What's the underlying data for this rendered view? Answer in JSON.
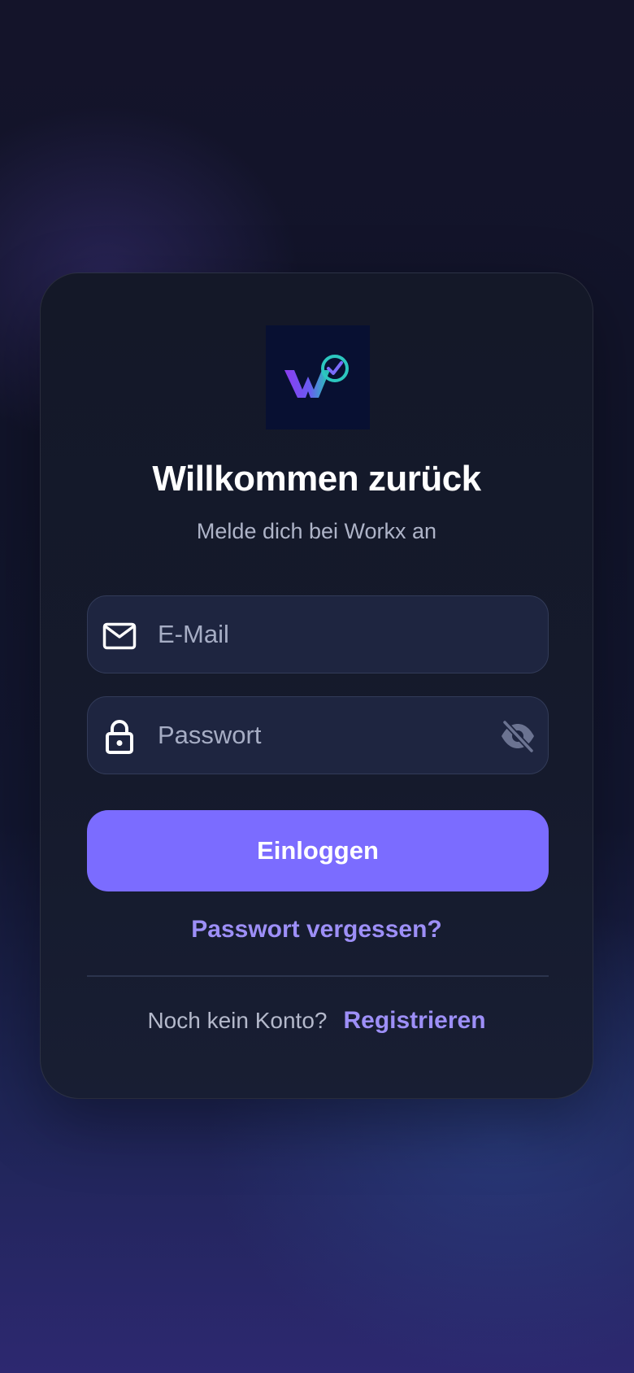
{
  "brand": {
    "logo_name": "Workx",
    "colors": {
      "accent": "#7b6cff",
      "link": "#9d8ff7",
      "field_background": "#1e2540",
      "card_background": "#141828",
      "logo_background": "#081032"
    }
  },
  "login": {
    "title": "Willkommen zurück",
    "subtitle": "Melde dich bei Workx an",
    "email_field": {
      "placeholder": "E-Mail",
      "value": "",
      "icon": "mail-icon"
    },
    "password_field": {
      "placeholder": "Passwort",
      "value": "",
      "icon": "lock-icon",
      "toggle_icon": "eye-off-icon"
    },
    "submit_label": "Einloggen",
    "forgot_label": "Passwort vergessen?",
    "signup_prompt": "Noch kein Konto?",
    "signup_label": "Registrieren"
  }
}
